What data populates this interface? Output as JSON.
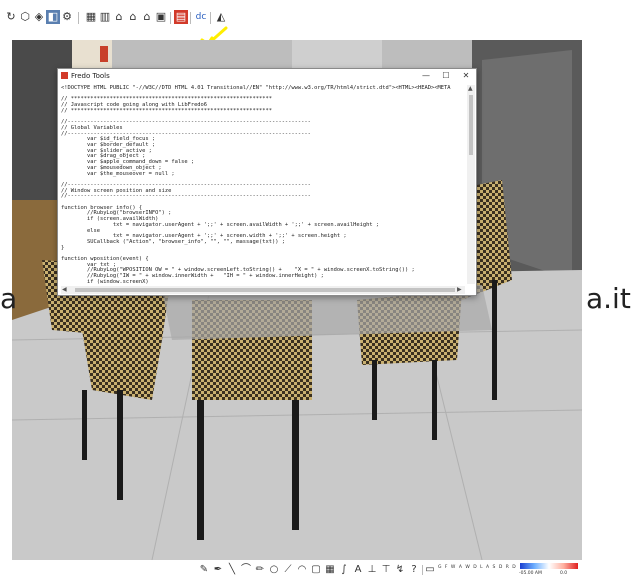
{
  "toolbar": {
    "icons": [
      "rotate-icon",
      "polygon-icon",
      "cube-icon",
      "layer-icon",
      "tool-icon",
      "grid-icon",
      "building-icon",
      "home-icon",
      "house-outline-icon",
      "store-icon",
      "red-box-icon",
      "fredo-tools-icon",
      "chart-icon"
    ]
  },
  "watermark": {
    "left": "a",
    "right": "a.it"
  },
  "dialog": {
    "title": "Fredo Tools",
    "minimize": "—",
    "maximize": "☐",
    "close": "✕",
    "code_lines": [
      "<!DOCTYPE HTML PUBLIC \"-//W3C//DTD HTML 4.01 Transitional//EN\" \"http://www.w3.org/TR/html4/strict.dtd\"><HTML><HEAD><META",
      "",
      "// **************************************************************",
      "// Javascript code going along with LibFredo6",
      "// **************************************************************",
      "",
      "//---------------------------------------------------------------------------",
      "// Global Variables",
      "//---------------------------------------------------------------------------",
      "        var $id_field_focus ;",
      "        var $border_default ;",
      "        var $slider_active ;",
      "        var $drag_object ;",
      "        var $apple_command_down = false ;",
      "        var $mousedown_object ;",
      "        var $the_mouseover = null ;",
      "",
      "//---------------------------------------------------------------------------",
      "// Window screen position and size",
      "//---------------------------------------------------------------------------",
      "",
      "function browser_info() {",
      "        //RubyLog(\"browserINFO\") ;",
      "        if (screen.availWidth)",
      "                txt = navigator.userAgent + ';;' + screen.availWidth + ';;' + screen.availHeight ;",
      "        else",
      "                txt = navigator.userAgent + ';;' + screen.width + ';;' + screen.height ;",
      "        SUCallback (\"Action\", \"browser_info\", \"\", \"\", massage(txt)) ;",
      "}",
      "",
      "function wposition(event) {",
      "        var txt ;",
      "        //RubyLog(\"WPOSITION OW = \" + window.screenLeft.toString() +    \"X = \" + window.screenX.toString()) ;",
      "        //RubyLog(\"IW = \" + window.innerWidth +   \"IH = \" + window.innerHeight) ;",
      "        if (window.screenX)"
    ]
  },
  "bottombar": {
    "icons": [
      "brush-icon",
      "pen-icon",
      "line-icon",
      "curve-icon",
      "edit-icon",
      "circle-icon",
      "diagonal-icon",
      "arc-icon",
      "box-icon",
      "grid-square-icon",
      "curve2-icon",
      "text-icon",
      "pin-icon",
      "ruler-icon",
      "arrow-icon",
      "help-icon",
      "eraser-icon",
      "window-icon"
    ],
    "legend": "G F W A W D L A S D R D",
    "grad_min": "-05.00 AM",
    "grad_max": "0.0"
  },
  "colors": {
    "arrow": "#ffee00",
    "gradient_start": "#1a3fd0",
    "gradient_end": "#e02020"
  }
}
